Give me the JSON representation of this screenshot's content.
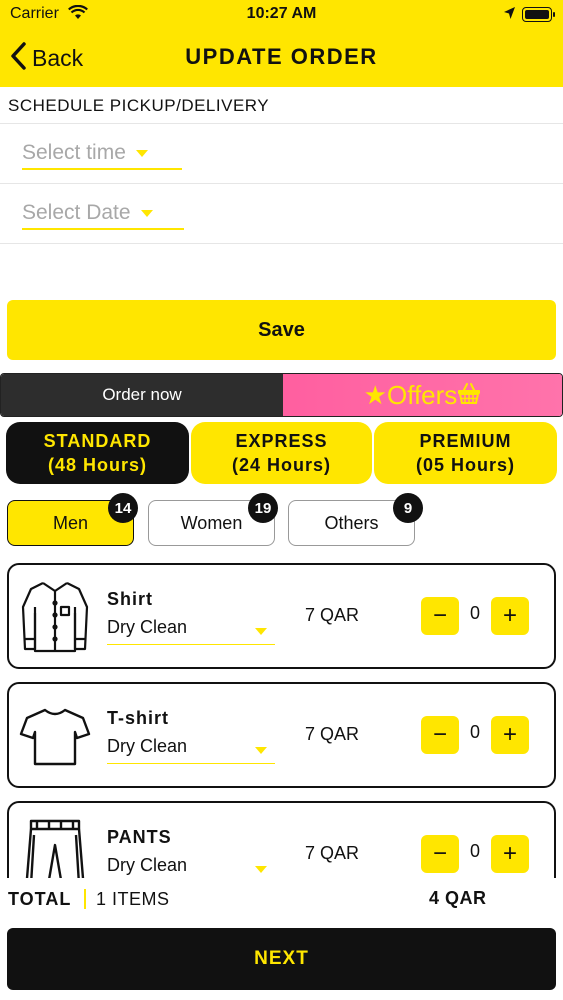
{
  "status_bar": {
    "carrier": "Carrier",
    "time": "10:27 AM"
  },
  "nav": {
    "back_label": "Back",
    "title": "UPDATE ORDER"
  },
  "schedule": {
    "title": "SCHEDULE PICKUP/DELIVERY",
    "time_placeholder": "Select time",
    "date_placeholder": "Select Date"
  },
  "save_label": "Save",
  "order_tabs": {
    "order_now": "Order now",
    "offers": "Offers"
  },
  "services": [
    {
      "name": "STANDARD",
      "duration": "(48 Hours)",
      "active": true
    },
    {
      "name": "EXPRESS",
      "duration": "(24 Hours)",
      "active": false
    },
    {
      "name": "PREMIUM",
      "duration": "(05 Hours)",
      "active": false
    }
  ],
  "categories": [
    {
      "label": "Men",
      "count": "14",
      "active": true
    },
    {
      "label": "Women",
      "count": "19",
      "active": false
    },
    {
      "label": "Others",
      "count": "9",
      "active": false
    }
  ],
  "items": [
    {
      "name": "Shirt",
      "service": "Dry Clean",
      "price": "7 QAR",
      "quantity": "0",
      "icon": "shirt-icon"
    },
    {
      "name": "T-shirt",
      "service": "Dry Clean",
      "price": "7 QAR",
      "quantity": "0",
      "icon": "tshirt-icon"
    },
    {
      "name": "PANTS",
      "service": "Dry Clean",
      "price": "7 QAR",
      "quantity": "0",
      "icon": "pants-icon"
    }
  ],
  "stepper": {
    "minus": "−",
    "plus": "+"
  },
  "totals": {
    "label": "TOTAL",
    "items": "1 ITEMS",
    "amount": "4 QAR"
  },
  "next_label": "NEXT",
  "colors": {
    "brand_yellow": "#ffe600",
    "dark": "#111111",
    "offers_pink": "#ff66a6"
  }
}
